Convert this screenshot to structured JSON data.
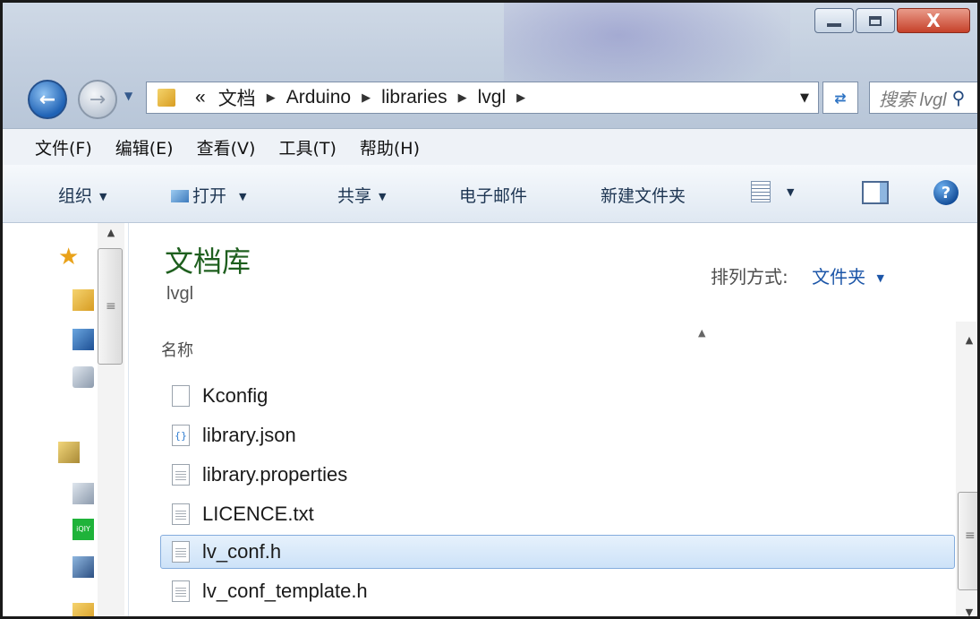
{
  "window": {
    "buttons": {
      "close_label": "X"
    }
  },
  "address": {
    "crumbs": [
      "«",
      "文档",
      "Arduino",
      "libraries",
      "lvgl"
    ],
    "search_placeholder": "搜索 lvgl"
  },
  "menubar": {
    "items": [
      "文件(F)",
      "编辑(E)",
      "查看(V)",
      "工具(T)",
      "帮助(H)"
    ]
  },
  "toolbar": {
    "organize": "组织",
    "open": "打开",
    "share": "共享",
    "email": "电子邮件",
    "new_folder": "新建文件夹"
  },
  "library": {
    "title": "文档库",
    "subtitle": "lvgl",
    "arrange_label": "排列方式:",
    "arrange_value": "文件夹"
  },
  "file_list": {
    "column_name": "名称",
    "files": [
      {
        "name": "Kconfig",
        "icon": "blank-file-icon"
      },
      {
        "name": "library.json",
        "icon": "json-file-icon"
      },
      {
        "name": "library.properties",
        "icon": "text-file-icon"
      },
      {
        "name": "LICENCE.txt",
        "icon": "text-file-icon"
      },
      {
        "name": "lv_conf.h",
        "icon": "text-file-icon",
        "selected": true
      },
      {
        "name": "lv_conf_template.h",
        "icon": "text-file-icon"
      }
    ]
  },
  "colors": {
    "library_title": "#1e5f1e",
    "link_blue": "#1c56a8",
    "selection": "#cde2f8"
  }
}
